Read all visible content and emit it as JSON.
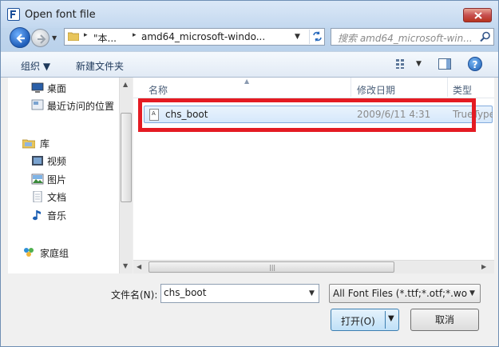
{
  "window": {
    "title": "Open font file",
    "close_glyph": "✕"
  },
  "address": {
    "crumbs": [
      "\"本...",
      "amd64_microsoft-windo..."
    ],
    "sep": "▸",
    "dropdown": "▼"
  },
  "search": {
    "placeholder": "搜索 amd64_microsoft-win..."
  },
  "toolbar": {
    "organize": "组织 ▼",
    "new_folder": "新建文件夹",
    "view_drop": "▼",
    "help": "?"
  },
  "nav": {
    "items": [
      {
        "label": "桌面",
        "icon": "desktop-icon"
      },
      {
        "label": "最近访问的位置",
        "icon": "recent-places-icon"
      },
      {
        "label": "库",
        "icon": "library-icon"
      },
      {
        "label": "视频",
        "icon": "videos-icon"
      },
      {
        "label": "图片",
        "icon": "pictures-icon"
      },
      {
        "label": "文档",
        "icon": "documents-icon"
      },
      {
        "label": "音乐",
        "icon": "music-icon"
      },
      {
        "label": "家庭组",
        "icon": "homegroup-icon"
      }
    ]
  },
  "columns": {
    "name": "名称",
    "date": "修改日期",
    "type": "类型"
  },
  "files": [
    {
      "name": "chs_boot",
      "date": "2009/6/11 4:31",
      "type": "TrueType",
      "icon": "font-file-icon"
    }
  ],
  "bottom": {
    "filename_label": "文件名(N):",
    "filename_value": "chs_boot",
    "filter_value": "All Font Files (*.ttf;*.otf;*.woff",
    "open_label": "打开(O)",
    "cancel_label": "取消"
  },
  "colors": {
    "highlight": "#e41b23",
    "selection": "#d6e8fb"
  }
}
